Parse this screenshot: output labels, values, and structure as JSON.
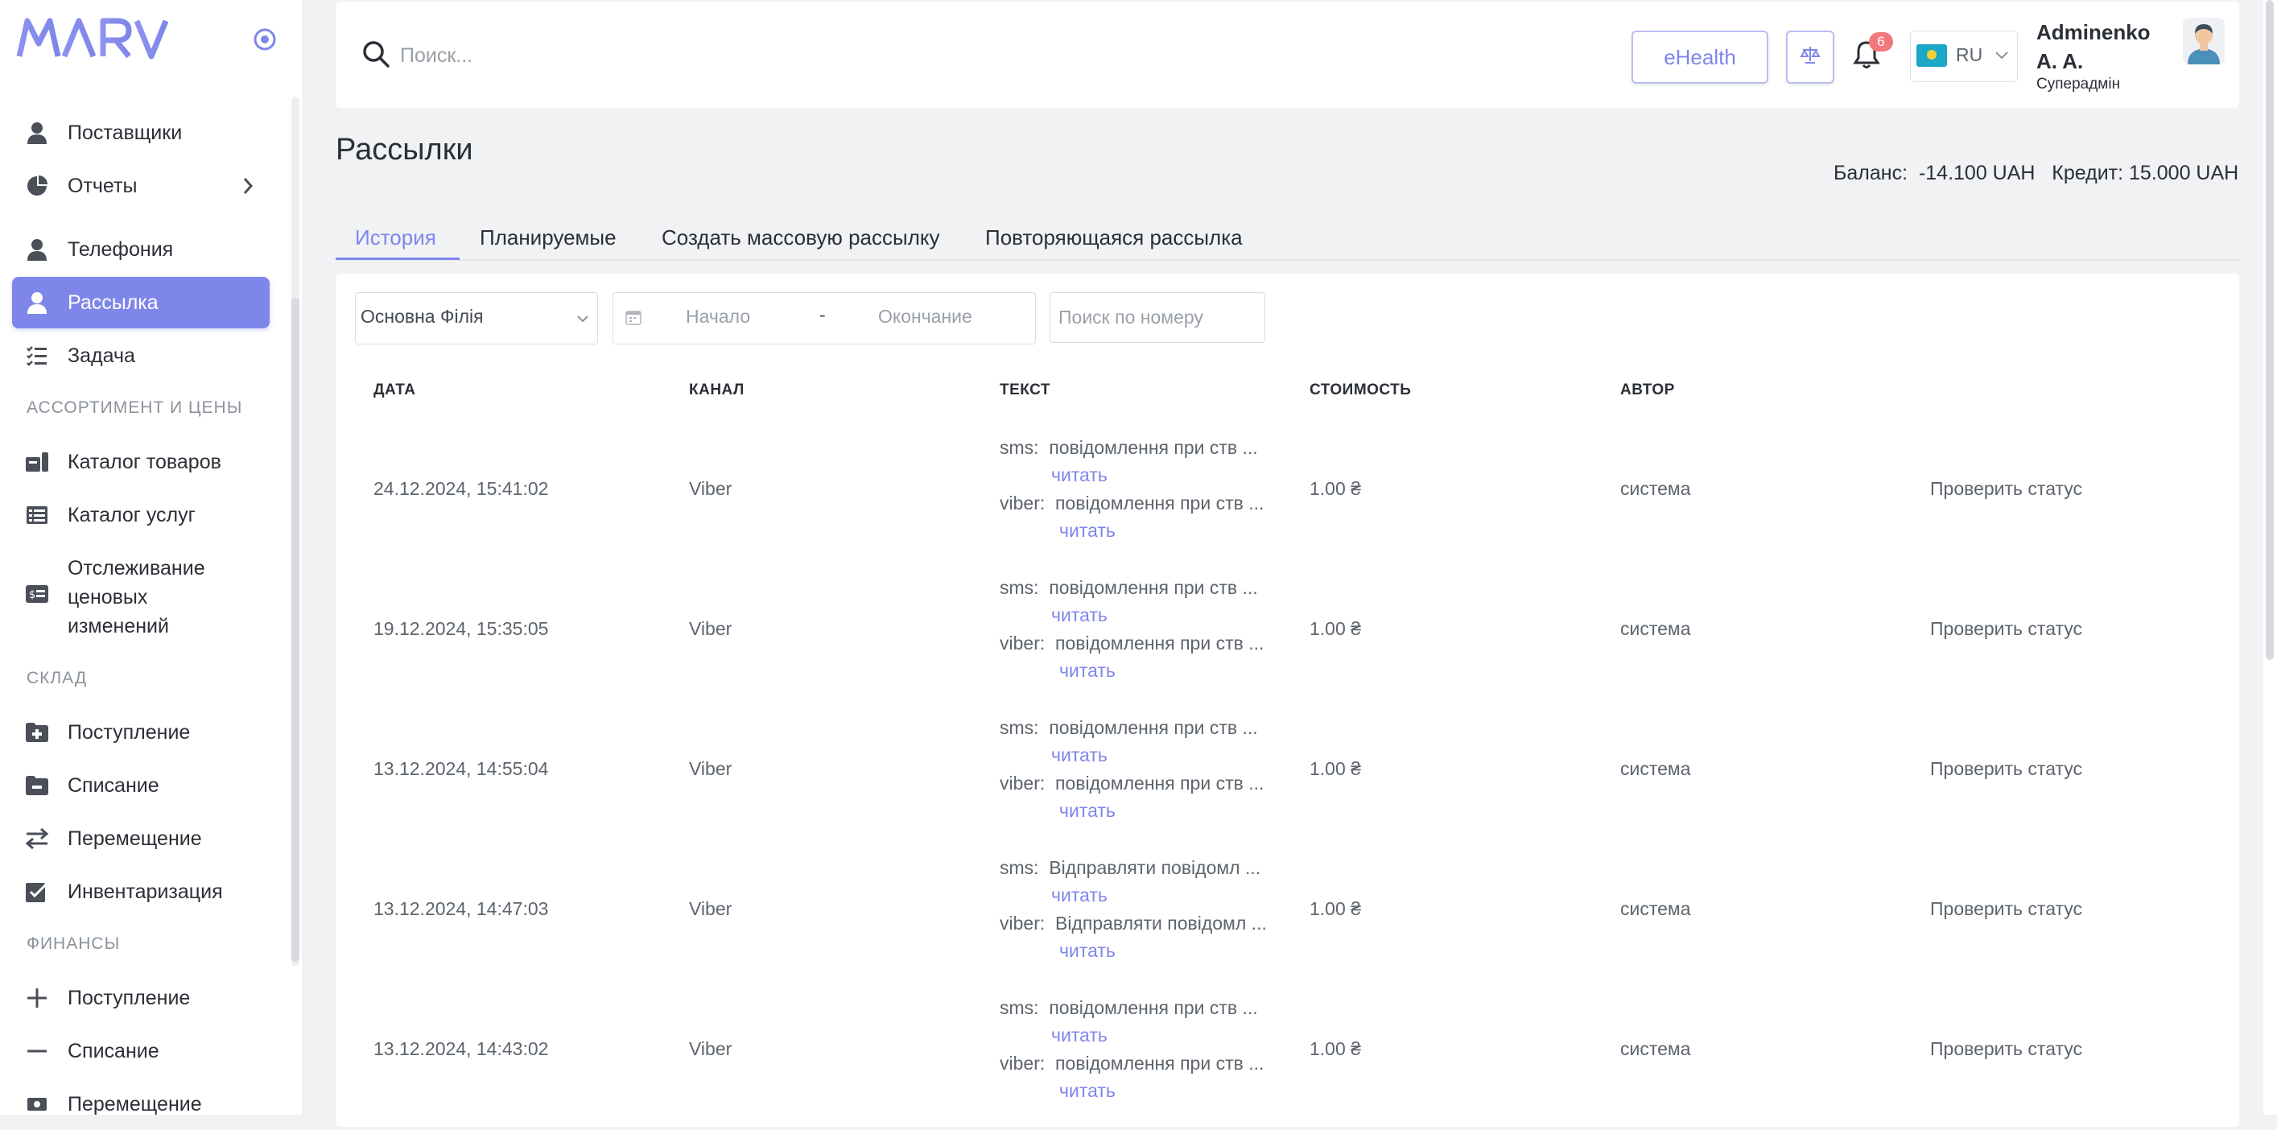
{
  "brand": {
    "logo_text": "MARVI",
    "accent": "#7f86ea"
  },
  "sidebar": {
    "items": [
      {
        "label": "Поставщики",
        "icon": "user-icon"
      },
      {
        "label": "Отчеты",
        "icon": "pie-chart-icon",
        "has_submenu": true
      },
      {
        "label": "Телефония",
        "icon": "user-icon"
      },
      {
        "label": "Рассылка",
        "icon": "user-icon",
        "active": true
      },
      {
        "label": "Задача",
        "icon": "checklist-icon"
      }
    ],
    "sections": [
      {
        "title": "АССОРТИМЕНТ И ЦЕНЫ",
        "items": [
          {
            "label": "Каталог товаров",
            "icon": "catalog-icon"
          },
          {
            "label": "Каталог услуг",
            "icon": "list-icon"
          },
          {
            "label": "Отслеживание ценовых изменений",
            "label_lines": [
              "Отслеживание",
              "ценовых",
              "изменений"
            ],
            "icon": "price-tag-icon"
          }
        ]
      },
      {
        "title": "СКЛАД",
        "items": [
          {
            "label": "Поступление",
            "icon": "folder-plus-icon"
          },
          {
            "label": "Списание",
            "icon": "folder-minus-icon"
          },
          {
            "label": "Перемещение",
            "icon": "transfer-arrows-icon"
          },
          {
            "label": "Инвентаризация",
            "icon": "inventory-check-icon"
          }
        ]
      },
      {
        "title": "ФИНАНСЫ",
        "items": [
          {
            "label": "Поступление",
            "icon": "plus-icon"
          },
          {
            "label": "Списание",
            "icon": "minus-icon"
          },
          {
            "label": "Перемещение",
            "icon": "money-transfer-icon"
          }
        ]
      }
    ]
  },
  "header": {
    "search_placeholder": "Поиск...",
    "ehealth_label": "eHealth",
    "notifications_count": "6",
    "language": "RU",
    "user": {
      "name_line1": "Adminenko",
      "name_line2": "A. A.",
      "role": "Суперадмін"
    }
  },
  "page": {
    "title": "Рассылки",
    "balance_text": "Баланс:  -14.100 UAH   Кредит: 15.000 UAH"
  },
  "tabs": [
    {
      "label": "История",
      "active": true
    },
    {
      "label": "Планируемые"
    },
    {
      "label": "Создать массовую рассылку"
    },
    {
      "label": "Повторяющаяся рассылка"
    }
  ],
  "filters": {
    "branch": "Основна Філія",
    "date_start_placeholder": "Начало",
    "date_separator": "-",
    "date_end_placeholder": "Окончание",
    "phone_placeholder": "Поиск по номеру"
  },
  "table": {
    "headers": [
      "ДАТА",
      "КАНАЛ",
      "ТЕКСТ",
      "СТОИМОСТЬ",
      "АВТОР"
    ],
    "read_label": "читать",
    "status_label": "Проверить статус",
    "rows": [
      {
        "date": "24.12.2024, 15:41:02",
        "channel": "Viber",
        "sms": "sms:  повідомлення при ств ...",
        "viber": "viber:  повідомлення при ств ...",
        "cost": "1.00 ₴",
        "author": "система"
      },
      {
        "date": "19.12.2024, 15:35:05",
        "channel": "Viber",
        "sms": "sms:  повідомлення при ств ...",
        "viber": "viber:  повідомлення при ств ...",
        "cost": "1.00 ₴",
        "author": "система"
      },
      {
        "date": "13.12.2024, 14:55:04",
        "channel": "Viber",
        "sms": "sms:  повідомлення при ств ...",
        "viber": "viber:  повідомлення при ств ...",
        "cost": "1.00 ₴",
        "author": "система"
      },
      {
        "date": "13.12.2024, 14:47:03",
        "channel": "Viber",
        "sms": "sms:  Відправляти повідомл ...",
        "viber": "viber:  Відправляти повідомл ...",
        "cost": "1.00 ₴",
        "author": "система"
      },
      {
        "date": "13.12.2024, 14:43:02",
        "channel": "Viber",
        "sms": "sms:  повідомлення при ств ...",
        "viber": "viber:  повідомлення при ств ...",
        "cost": "1.00 ₴",
        "author": "система"
      }
    ]
  }
}
